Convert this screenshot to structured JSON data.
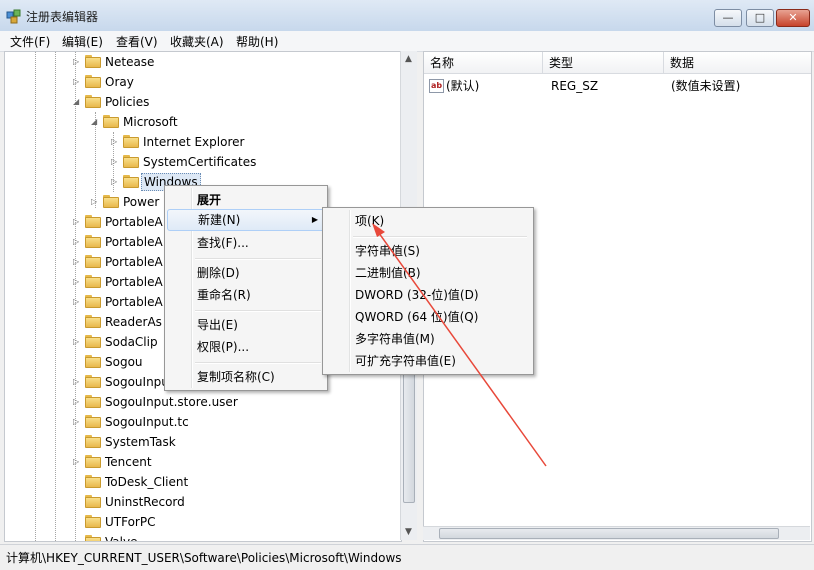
{
  "window": {
    "title": "注册表编辑器",
    "buttons": {
      "minimize": "—",
      "maximize": "□",
      "close": "✕"
    }
  },
  "menubar": [
    "文件(F)",
    "编辑(E)",
    "查看(V)",
    "收藏夹(A)",
    "帮助(H)"
  ],
  "tree": {
    "items": [
      {
        "label": "Netease",
        "expander": "▷"
      },
      {
        "label": "Oray",
        "expander": "▷"
      },
      {
        "label": "Policies",
        "expander": "◢"
      },
      {
        "label": "Microsoft",
        "expander": "◢"
      },
      {
        "label": "Internet Explorer",
        "expander": "▷"
      },
      {
        "label": "SystemCertificates",
        "expander": "▷"
      },
      {
        "label": "Windows",
        "expander": "▷"
      },
      {
        "label": "Power",
        "expander": "▷"
      },
      {
        "label": "PortableA",
        "expander": "▷"
      },
      {
        "label": "PortableA",
        "expander": "▷"
      },
      {
        "label": "PortableA",
        "expander": "▷"
      },
      {
        "label": "PortableA",
        "expander": "▷"
      },
      {
        "label": "PortableA",
        "expander": "▷"
      },
      {
        "label": "ReaderAs",
        "expander": ""
      },
      {
        "label": "SodaClip",
        "expander": "▷"
      },
      {
        "label": "Sogou",
        "expander": ""
      },
      {
        "label": "SogouInpu",
        "expander": "▷"
      },
      {
        "label": "SogouInput.store.user",
        "expander": "▷"
      },
      {
        "label": "SogouInput.tc",
        "expander": "▷"
      },
      {
        "label": "SystemTask",
        "expander": ""
      },
      {
        "label": "Tencent",
        "expander": "▷"
      },
      {
        "label": "ToDesk_Client",
        "expander": ""
      },
      {
        "label": "UninstRecord",
        "expander": ""
      },
      {
        "label": "UTForPC",
        "expander": ""
      },
      {
        "label": "Valve",
        "expander": ""
      }
    ],
    "selected": "Windows"
  },
  "list": {
    "columns": [
      "名称",
      "类型",
      "数据"
    ],
    "rows": [
      {
        "icon": "ab",
        "name": "(默认)",
        "type": "REG_SZ",
        "data": "(数值未设置)"
      }
    ]
  },
  "context_menu": {
    "items": [
      "展开",
      "新建(N)",
      "查找(F)...",
      "删除(D)",
      "重命名(R)",
      "导出(E)",
      "权限(P)...",
      "复制项名称(C)"
    ],
    "hovered": "新建(N)"
  },
  "submenu": {
    "items": [
      "项(K)",
      "字符串值(S)",
      "二进制值(B)",
      "DWORD (32-位)值(D)",
      "QWORD (64 位)值(Q)",
      "多字符串值(M)",
      "可扩充字符串值(E)"
    ]
  },
  "statusbar": {
    "path": "计算机\\HKEY_CURRENT_USER\\Software\\Policies\\Microsoft\\Windows"
  },
  "colors": {
    "annotation_arrow": "#e8483a",
    "title_gradient_top": "#dfe9f5",
    "menu_hover": "#dfeaf7"
  }
}
